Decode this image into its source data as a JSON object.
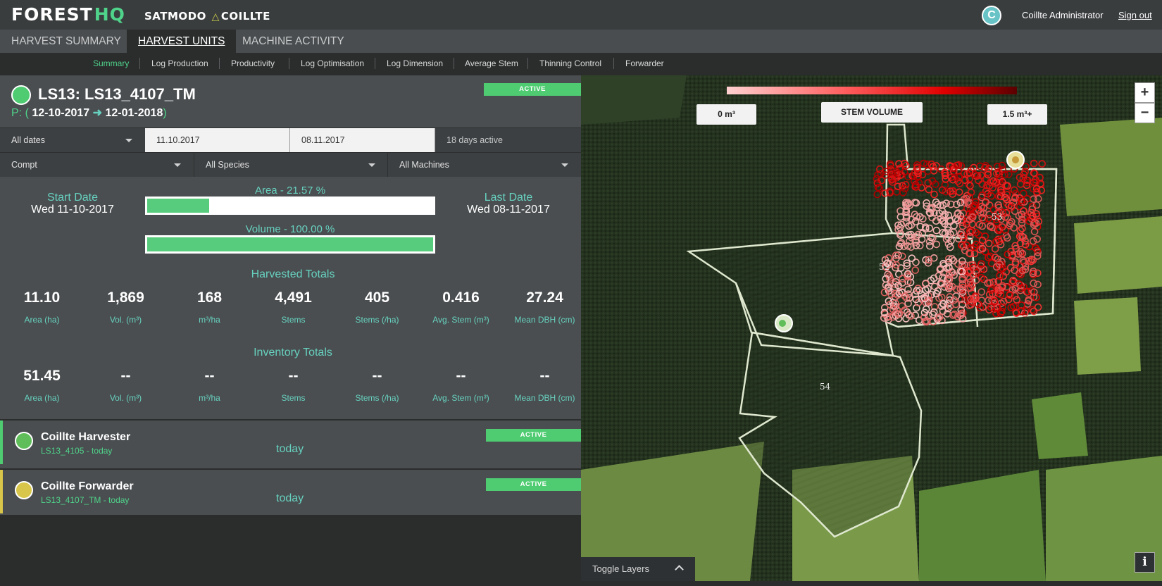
{
  "header": {
    "logo_forest": "FOREST",
    "logo_hq": "HQ",
    "brand_left": "SATMODO",
    "brand_right": "COILLTE",
    "user_initial": "C",
    "user_name": "Coillte Administrator",
    "signout": "Sign out"
  },
  "main_tabs": [
    {
      "label": "HARVEST SUMMARY",
      "active": false
    },
    {
      "label": "HARVEST UNITS",
      "active": true
    },
    {
      "label": "MACHINE ACTIVITY",
      "active": false
    }
  ],
  "sub_nav": [
    {
      "label": "Summary",
      "active": true
    },
    {
      "label": "Log Production"
    },
    {
      "label": "Productivity"
    },
    {
      "label": "Log Optimisation"
    },
    {
      "label": "Log Dimension"
    },
    {
      "label": "Average Stem"
    },
    {
      "label": "Thinning Control"
    },
    {
      "label": "Forwarder"
    }
  ],
  "unit": {
    "title": "LS13: LS13_4107_TM",
    "period_prefix": "P: (",
    "period_start": "12-10-2017",
    "period_end": "12-01-2018",
    "period_suffix": ")",
    "status": "ACTIVE",
    "status_color": "#4fcc72"
  },
  "filters": {
    "date_range": "All dates",
    "date_from": "11.10.2017",
    "date_to": "08.11.2017",
    "days_active": "18 days active",
    "compt": "Compt",
    "species": "All Species",
    "machines": "All Machines"
  },
  "progress": {
    "start_label": "Start Date",
    "start_value": "Wed 11-10-2017",
    "last_label": "Last Date",
    "last_value": "Wed 08-11-2017",
    "area_label": "Area - 21.57 %",
    "area_fraction": 0.2157,
    "volume_label": "Volume - 100.00 %",
    "volume_fraction": 1.0
  },
  "harvested": {
    "title": "Harvested Totals",
    "stats": [
      {
        "value": "11.10",
        "label": "Area (ha)"
      },
      {
        "value": "1,869",
        "label": "Vol. (m³)"
      },
      {
        "value": "168",
        "label": "m³/ha"
      },
      {
        "value": "4,491",
        "label": "Stems"
      },
      {
        "value": "405",
        "label": "Stems (/ha)"
      },
      {
        "value": "0.416",
        "label": "Avg. Stem (m³)"
      },
      {
        "value": "27.24",
        "label": "Mean DBH (cm)"
      }
    ]
  },
  "inventory": {
    "title": "Inventory Totals",
    "stats": [
      {
        "value": "51.45",
        "label": "Area (ha)"
      },
      {
        "value": "--",
        "label": "Vol. (m³)"
      },
      {
        "value": "--",
        "label": "m³/ha"
      },
      {
        "value": "--",
        "label": "Stems"
      },
      {
        "value": "--",
        "label": "Stems (/ha)"
      },
      {
        "value": "--",
        "label": "Avg. Stem (m³)"
      },
      {
        "value": "--",
        "label": "Mean DBH (cm)"
      }
    ]
  },
  "machines": [
    {
      "name": "Coillte Harvester",
      "sub": "LS13_4105 - today",
      "when": "today",
      "status": "ACTIVE",
      "stripe": "#4fcc72",
      "icon": "harvester-icon"
    },
    {
      "name": "Coillte Forwarder",
      "sub": "LS13_4107_TM - today",
      "when": "today",
      "status": "ACTIVE",
      "stripe": "#d7c64a",
      "icon": "forwarder-icon"
    }
  ],
  "map": {
    "legend_min": "0 m³",
    "legend_title": "STEM VOLUME",
    "legend_max": "1.5 m³+",
    "zoom_in": "+",
    "zoom_out": "−",
    "compartments": [
      "52",
      "53",
      "54"
    ],
    "toggle_layers": "Toggle Layers",
    "info": "i"
  }
}
